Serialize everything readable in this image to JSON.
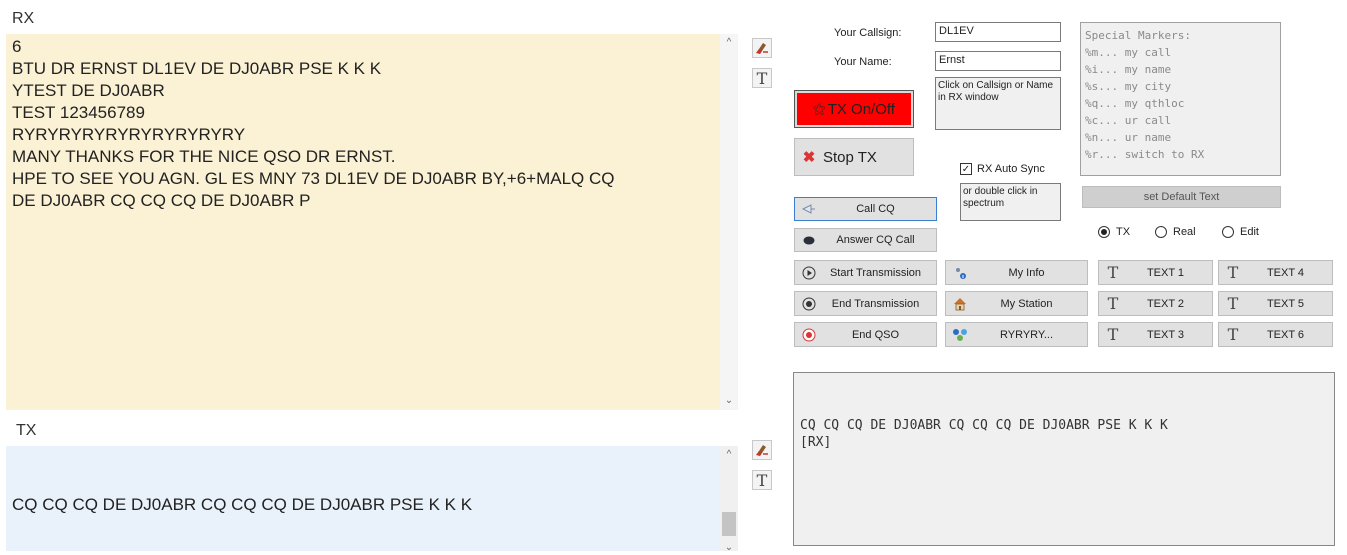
{
  "rx": {
    "label": "RX",
    "lines": [
      "6",
      "BTU DR ERNST DL1EV DE DJ0ABR PSE K K K",
      "YTEST DE DJ0ABR",
      "TEST 123456789",
      "RYRYRYRYRYRYRYRYRYRY",
      "MANY THANKS FOR THE NICE QSO DR ERNST.",
      "HPE TO SEE YOU AGN. GL ES MNY 73 DL1EV DE DJ0ABR BY,+6+MALQ CQ",
      "DE DJ0ABR CQ CQ CQ DE DJ0ABR P"
    ]
  },
  "tx": {
    "label": "TX",
    "text": "CQ CQ CQ DE DJ0ABR CQ CQ CQ DE DJ0ABR PSE K K K"
  },
  "form": {
    "callsign_label": "Your Callsign:",
    "callsign_value": "DL1EV",
    "name_label": "Your Name:",
    "name_value": "Ernst",
    "click_hint": "Click on Callsign or Name in RX window",
    "double_click_hint": "or double click in spectrum",
    "rx_auto_sync_label": "RX Auto Sync",
    "rx_auto_sync_checked": true
  },
  "special_markers": {
    "text": "Special Markers:\n%m... my call\n%i... my name\n%s... my city\n%q... my qthloc\n%c... ur call\n%n... ur name\n%r... switch to RX"
  },
  "buttons": {
    "tx_onoff": "TX On/Off",
    "tx_onoff_color": "#ff0000",
    "stop_tx": "Stop TX",
    "call_cq": "Call CQ",
    "answer_cq": "Answer CQ Call",
    "set_default": "set Default Text",
    "start_transmission": "Start Transmission",
    "end_transmission": "End Transmission",
    "end_qso": "End QSO",
    "my_info": "My Info",
    "my_station": "My Station",
    "ryryry": "RYRYRY...",
    "text1": "TEXT 1",
    "text2": "TEXT 2",
    "text3": "TEXT 3",
    "text4": "TEXT 4",
    "text5": "TEXT 5",
    "text6": "TEXT 6"
  },
  "mode": {
    "options": [
      "TX",
      "Real",
      "Edit"
    ],
    "selected": "TX"
  },
  "output": {
    "text": "CQ CQ CQ DE DJ0ABR CQ CQ CQ DE DJ0ABR PSE K K K\n[RX]"
  }
}
